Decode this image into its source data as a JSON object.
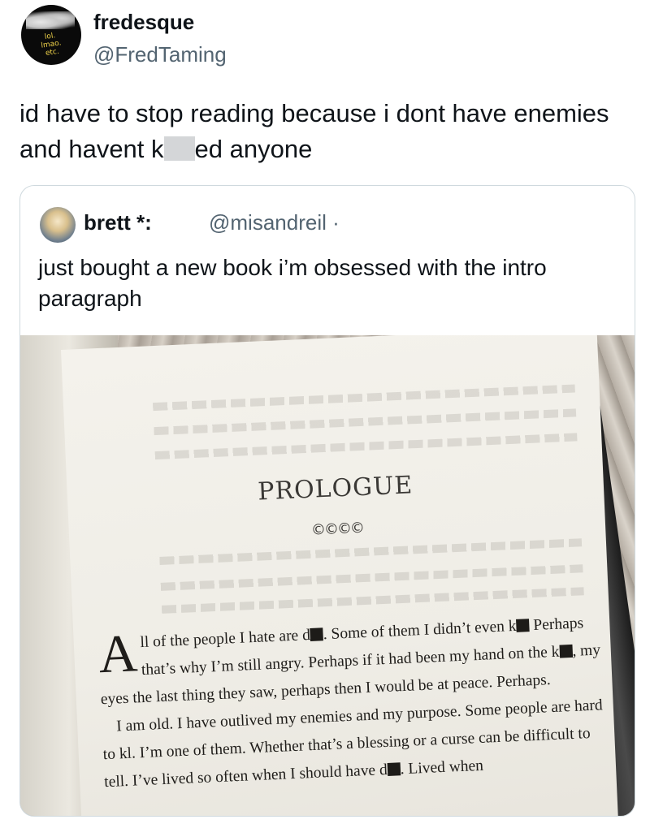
{
  "tweet": {
    "avatar_text": "lol.\nlmao.\netc.",
    "display_name": "fredesque",
    "handle": "@FredTaming",
    "text_before": "id have to stop reading because i dont have enemies and havent k",
    "text_after": "ed anyone"
  },
  "quote": {
    "display_name": "brett *:",
    "handle": "@misandreil ·",
    "text": "just bought a new book i’m obsessed with the intro paragraph",
    "image": {
      "heading": "PROLOGUE",
      "ornament": "©©©©",
      "para1": {
        "dropcap": "A",
        "s1": "ll of the people I hate are d",
        "s2": ". Some of them I didn’t even k",
        "s3": " Perhaps that’s why I’m still angry. Perhaps if it had been my hand on the k",
        "s4": ", my eyes the last thing they saw, perhaps then I would be at peace. Perhaps."
      },
      "para2": {
        "s1": "I am old. I have outlived my enemies and my purpose. Some people are hard to k",
        "s2": "l. I’m one of them. Whether that’s a blessing or a curse can be difficult to tell. I’ve lived so often when I should have d",
        "s3": ". Lived when"
      }
    }
  }
}
